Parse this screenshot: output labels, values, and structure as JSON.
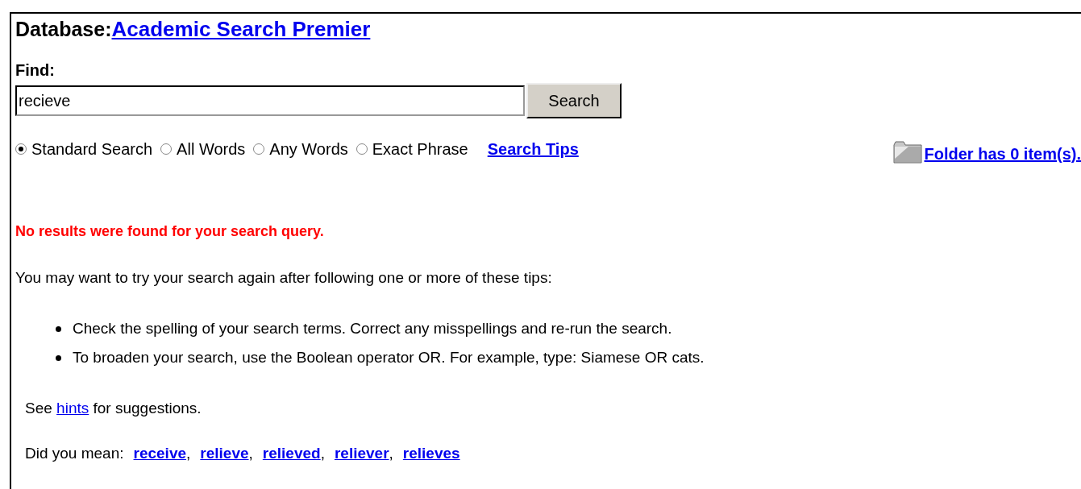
{
  "database": {
    "label": "Database:",
    "name": "Academic Search Premier"
  },
  "find": {
    "label": "Find:",
    "value": "recieve",
    "button": "Search"
  },
  "modes": [
    {
      "label": "Standard Search",
      "selected": true
    },
    {
      "label": "All Words",
      "selected": false
    },
    {
      "label": "Any Words",
      "selected": false
    },
    {
      "label": "Exact Phrase",
      "selected": false
    }
  ],
  "search_tips": "Search Tips",
  "folder": "Folder has 0 item(s).",
  "error": "No results were found for your search query.",
  "intro": "You may want to try your search again after following one or more of these tips:",
  "tips": [
    "Check the spelling of your search terms. Correct any misspellings and re-run the search.",
    "To broaden your search, use the Boolean operator OR. For example, type: Siamese OR cats."
  ],
  "hints": {
    "before": "See",
    "link": "hints",
    "after": "for suggestions."
  },
  "did_you_mean": {
    "label": "Did you mean:",
    "separator": ",",
    "suggestions": [
      "receive",
      "relieve",
      "relieved",
      "reliever",
      "relieves"
    ]
  }
}
